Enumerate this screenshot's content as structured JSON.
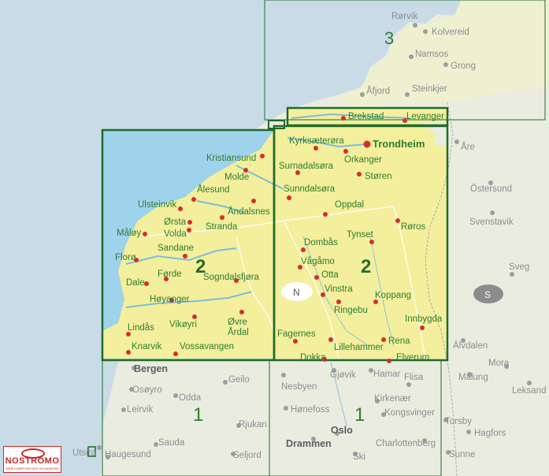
{
  "map": {
    "sheet_numbers": {
      "n3": "3",
      "n2_west": "2",
      "n2_east": "2",
      "n1_west": "1",
      "n1_east": "1"
    },
    "compass_label": "N",
    "country_label": "S",
    "places_in_frame": {
      "bronnoysund_area": {
        "rorvik": "Rørvik",
        "kolvereid": "Kolvereid",
        "namsos": "Namsos",
        "grong": "Grong",
        "afjord": "Åfjord",
        "steinkjer": "Steinkjer"
      },
      "trondheim_strip": {
        "brekstad": "Brekstad",
        "levanger": "Levanger"
      },
      "west": {
        "kristiansund": "Kristiansund",
        "molde": "Molde",
        "alesund": "Ålesund",
        "ulsteinvik": "Ulsteinvik",
        "orsta": "Ørsta",
        "volda": "Volda",
        "andalsnes": "Åndalsnes",
        "stranda": "Stranda",
        "maloy": "Måløy",
        "floro": "Florø",
        "sandane": "Sandane",
        "forde": "Førde",
        "dale": "Dale",
        "hoyanger": "Høyanger",
        "sogndalsfjora": "Sogndalsfjøra",
        "vikoyri": "Vikøyri",
        "ovre_ardal": "Øvre\nÅrdal",
        "lindas": "Lindås",
        "knarvik": "Knarvik",
        "vossavangen": "Vossavangen"
      },
      "east": {
        "kyrksaetrora": "Kyrksæterøra",
        "trondheim": "Trondheim",
        "surnadalsora": "Surnadalsøra",
        "orkanger": "Orkanger",
        "storen": "Støren",
        "sunndalsora": "Sunndalsøra",
        "oppdal": "Oppdal",
        "tynset": "Tynset",
        "roros": "Røros",
        "dombas": "Dombås",
        "vagamo": "Vågåmo",
        "otta": "Otta",
        "vinstra": "Vinstra",
        "ringebu": "Ringebu",
        "koppang": "Koppang",
        "innbygda": "Innbygda",
        "fagernes": "Fagernes",
        "lillehammer": "Lillehammer",
        "rena": "Rena",
        "dokka": "Dokka",
        "elverum": "Elverum"
      }
    },
    "places_outside": {
      "are": "Åre",
      "ostersund": "Östersund",
      "svenstavik": "Svenstavik",
      "sveg": "Sveg",
      "alvdalen": "Älvdalen",
      "mora": "Mora",
      "malung": "Malung",
      "leksand": "Leksand",
      "torsby": "Torsby",
      "hagfors": "Hagfors",
      "sunne": "Sunne",
      "bergen": "Bergen",
      "osoyro": "Osøyro",
      "odda": "Odda",
      "geilo": "Geilo",
      "nesbyen": "Nesbyen",
      "gjovik": "Gjøvik",
      "hamar": "Hamar",
      "flisa": "Flisa",
      "leirvik": "Leirvik",
      "honefoss": "Hønefoss",
      "kirkenaer": "Kirkenær",
      "kongsvinger": "Kongsvinger",
      "rjukan": "Rjukan",
      "oslo": "Oslo",
      "sauda": "Sauda",
      "drammen": "Drammen",
      "charlottenberg": "Charlottenberg",
      "utsira": "Utsira",
      "haugesund": "Haugesund",
      "seljord": "Seljord",
      "ski": "Ski"
    },
    "colors": {
      "sea": "#c9dbe6",
      "sea_focus": "#9fd3ec",
      "land_outside": "#e9ecdf",
      "land_focus": "#f3ef9c",
      "frame": "#1f6b2c",
      "place_dot": "#d32f2f",
      "place_label": "#2e7d32",
      "outside_label": "#8a8f92"
    }
  },
  "logo": {
    "name": "NOSTROMO",
    "tagline": "WEB COMPTOIR DES VOYAGEURS"
  }
}
